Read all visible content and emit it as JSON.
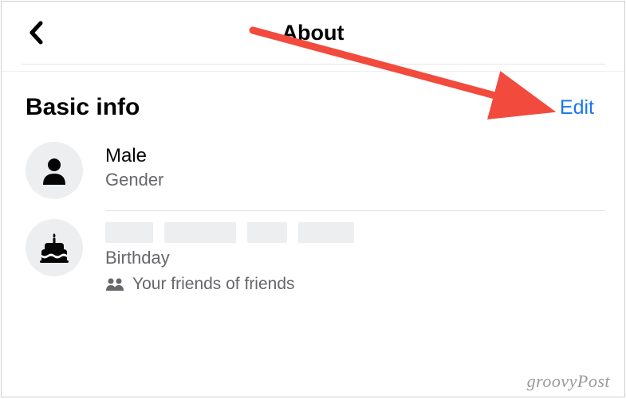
{
  "header": {
    "title": "About"
  },
  "section": {
    "title": "Basic info",
    "edit_label": "Edit"
  },
  "rows": {
    "gender": {
      "value": "Male",
      "label": "Gender"
    },
    "birthday": {
      "label": "Birthday",
      "audience": "Your friends of friends"
    }
  },
  "watermark": "groovyPost",
  "colors": {
    "link": "#1877f2",
    "arrow": "#f24a3d"
  }
}
